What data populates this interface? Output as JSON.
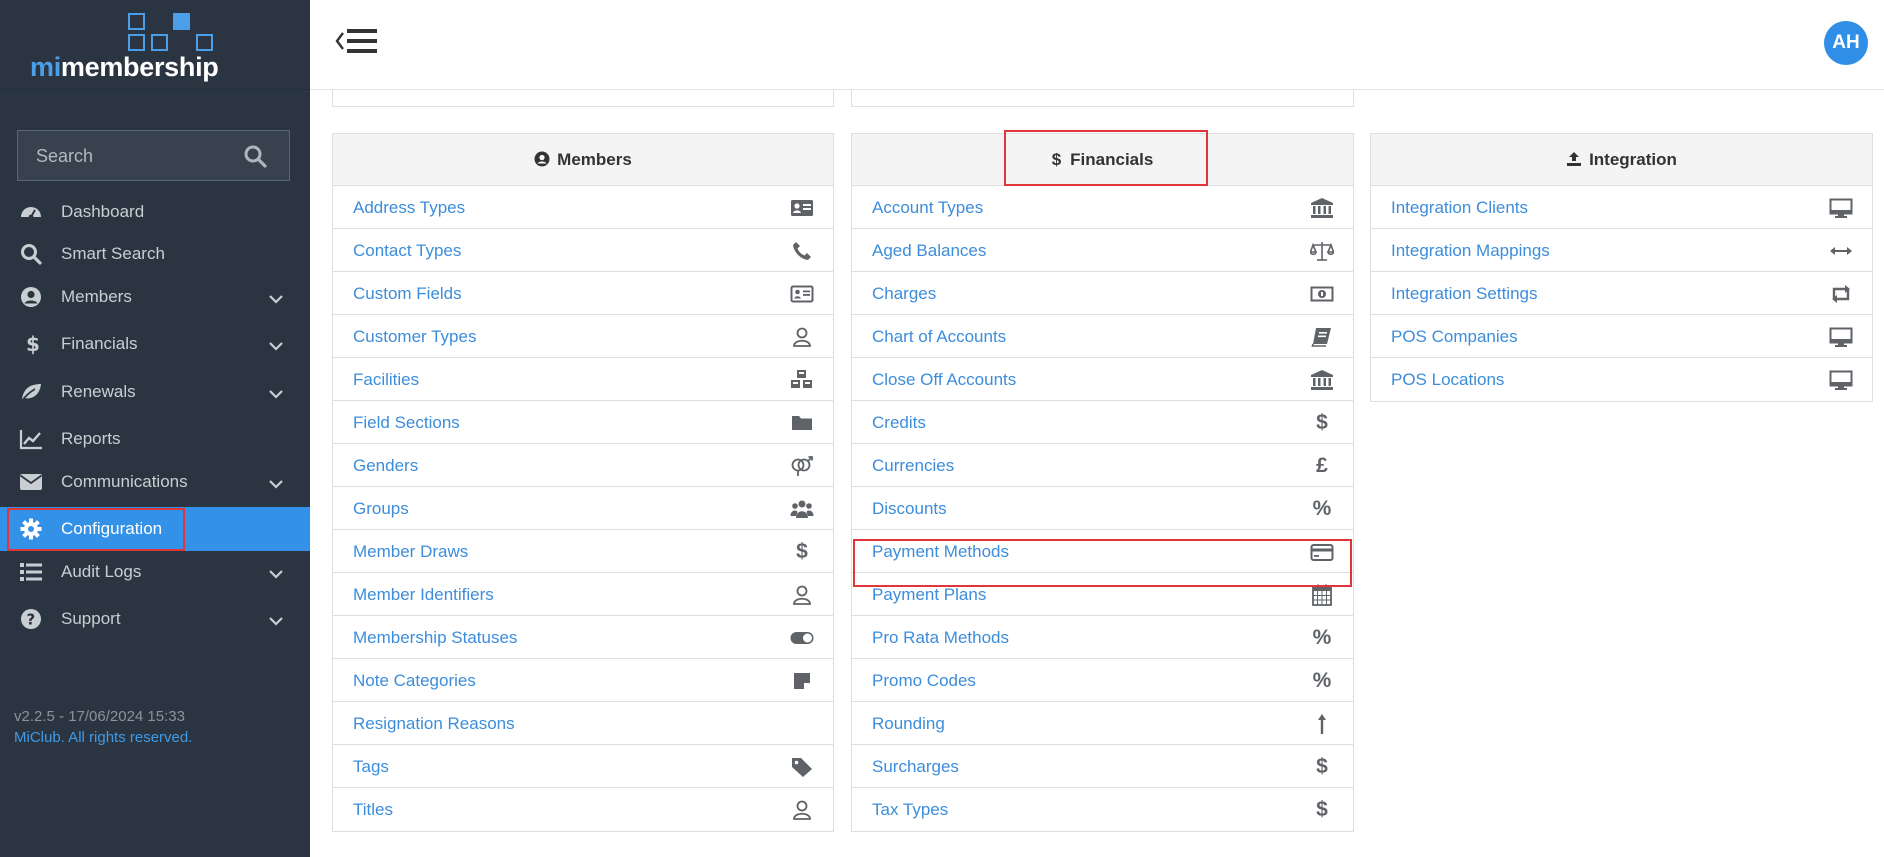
{
  "app": {
    "logo_mi": "mi",
    "logo_rest": "membership"
  },
  "search": {
    "placeholder": "Search"
  },
  "sidebar": {
    "items": [
      {
        "label": "Dashboard",
        "icon": "dashboard-icon"
      },
      {
        "label": "Smart Search",
        "icon": "search-icon"
      },
      {
        "label": "Members",
        "icon": "user-circle-icon",
        "expandable": true
      },
      {
        "label": "Financials",
        "icon": "dollar-icon",
        "expandable": true
      },
      {
        "label": "Renewals",
        "icon": "leaf-icon",
        "expandable": true
      },
      {
        "label": "Reports",
        "icon": "chart-line-icon"
      },
      {
        "label": "Communications",
        "icon": "envelope-icon",
        "expandable": true
      },
      {
        "label": "Configuration",
        "icon": "gear-icon",
        "active": true
      },
      {
        "label": "Audit Logs",
        "icon": "list-icon",
        "expandable": true
      },
      {
        "label": "Support",
        "icon": "question-icon",
        "expandable": true
      }
    ],
    "version": "v2.2.5 - 17/06/2024 15:33",
    "copyright": "MiClub. All rights reserved."
  },
  "user": {
    "initials": "AH"
  },
  "colors": {
    "sidebar_bg": "#2b3541",
    "accent": "#3491e8",
    "link": "#3c8ddb",
    "highlight": "#e0353a"
  },
  "panels": {
    "members": {
      "title": "Members",
      "items": [
        {
          "label": "Address Types",
          "icon": "address-card-icon"
        },
        {
          "label": "Contact Types",
          "icon": "phone-icon"
        },
        {
          "label": "Custom Fields",
          "icon": "id-card-icon"
        },
        {
          "label": "Customer Types",
          "icon": "user-icon"
        },
        {
          "label": "Facilities",
          "icon": "cubes-icon"
        },
        {
          "label": "Field Sections",
          "icon": "folder-icon"
        },
        {
          "label": "Genders",
          "icon": "genderless-icon"
        },
        {
          "label": "Groups",
          "icon": "users-icon"
        },
        {
          "label": "Member Draws",
          "icon": "dollar-icon"
        },
        {
          "label": "Member Identifiers",
          "icon": "user-icon"
        },
        {
          "label": "Membership Statuses",
          "icon": "toggle-icon"
        },
        {
          "label": "Note Categories",
          "icon": "sticky-note-icon"
        },
        {
          "label": "Resignation Reasons",
          "icon": ""
        },
        {
          "label": "Tags",
          "icon": "tag-icon"
        },
        {
          "label": "Titles",
          "icon": "user-icon"
        }
      ]
    },
    "financials": {
      "title": "Financials",
      "items": [
        {
          "label": "Account Types",
          "icon": "bank-icon"
        },
        {
          "label": "Aged Balances",
          "icon": "balance-scale-icon"
        },
        {
          "label": "Charges",
          "icon": "money-icon"
        },
        {
          "label": "Chart of Accounts",
          "icon": "book-icon"
        },
        {
          "label": "Close Off Accounts",
          "icon": "bank-icon"
        },
        {
          "label": "Credits",
          "icon": "dollar-icon",
          "glyph": "$"
        },
        {
          "label": "Currencies",
          "icon": "pound-icon",
          "glyph": "£"
        },
        {
          "label": "Discounts",
          "icon": "percent-icon",
          "glyph": "%"
        },
        {
          "label": "Payment Methods",
          "icon": "credit-card-icon"
        },
        {
          "label": "Payment Plans",
          "icon": "calendar-icon"
        },
        {
          "label": "Pro Rata Methods",
          "icon": "percent-icon",
          "glyph": "%"
        },
        {
          "label": "Promo Codes",
          "icon": "percent-icon",
          "glyph": "%"
        },
        {
          "label": "Rounding",
          "icon": "arrow-up-icon"
        },
        {
          "label": "Surcharges",
          "icon": "dollar-icon",
          "glyph": "$"
        },
        {
          "label": "Tax Types",
          "icon": "dollar-icon",
          "glyph": "$"
        }
      ]
    },
    "integration": {
      "title": "Integration",
      "items": [
        {
          "label": "Integration Clients",
          "icon": "desktop-icon"
        },
        {
          "label": "Integration Mappings",
          "icon": "arrows-h-icon"
        },
        {
          "label": "Integration Settings",
          "icon": "retweet-icon"
        },
        {
          "label": "POS Companies",
          "icon": "desktop-icon"
        },
        {
          "label": "POS Locations",
          "icon": "desktop-icon"
        }
      ]
    }
  }
}
